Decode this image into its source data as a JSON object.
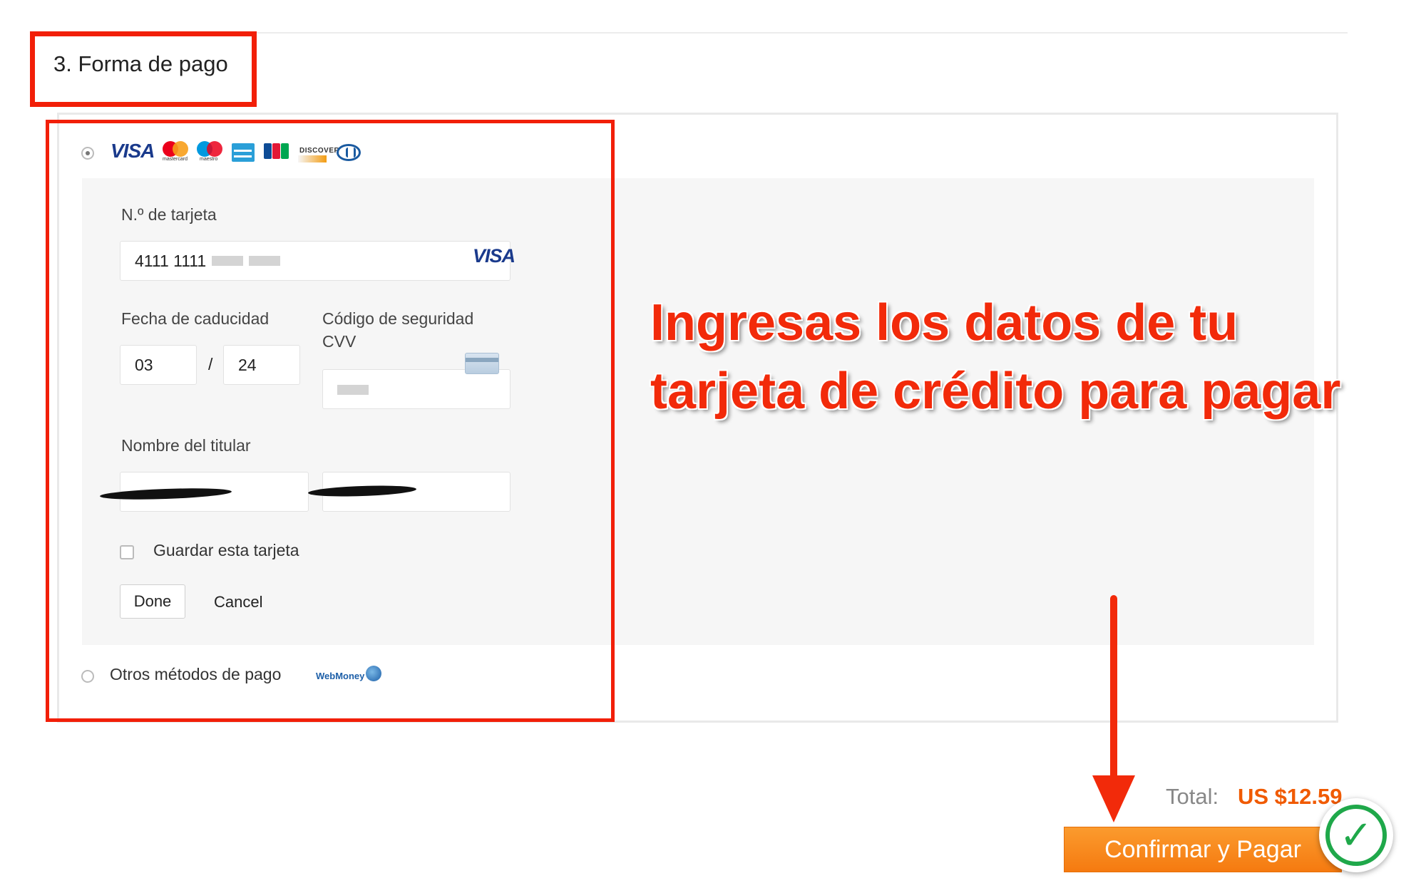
{
  "section": {
    "title": "3. Forma de pago"
  },
  "card_brands": [
    {
      "name": "visa",
      "label": "VISA"
    },
    {
      "name": "mastercard",
      "label": "mastercard"
    },
    {
      "name": "maestro",
      "label": "maestro"
    },
    {
      "name": "amex",
      "label": ""
    },
    {
      "name": "jcb",
      "label": "JCB"
    },
    {
      "name": "discover",
      "label": "DISCOVER"
    },
    {
      "name": "diners",
      "label": ""
    }
  ],
  "form": {
    "card_number_label": "N.º de tarjeta",
    "card_number_value": "4111 1111",
    "card_brand_detected": "VISA",
    "expiry_label": "Fecha de caducidad",
    "expiry_month": "03",
    "expiry_separator": "/",
    "expiry_year": "24",
    "cvv_label_line1": "Código de seguridad",
    "cvv_label_line2": "CVV",
    "holder_label": "Nombre del titular",
    "save_card_label": "Guardar esta tarjeta",
    "done_button": "Done",
    "cancel_button": "Cancel"
  },
  "other_methods": {
    "label": "Otros métodos de pago",
    "webmoney": "WebMoney"
  },
  "annotation": {
    "line1": "Ingresas los datos de tu",
    "line2": "tarjeta de crédito para pagar",
    "color": "#f22a0a"
  },
  "total": {
    "label": "Total:",
    "value": "US $12.59"
  },
  "confirm_button": "Confirmar y Pagar",
  "colors": {
    "annotation_red": "#f21f08",
    "accent_orange": "#f57a10",
    "check_green": "#1fa84a"
  }
}
